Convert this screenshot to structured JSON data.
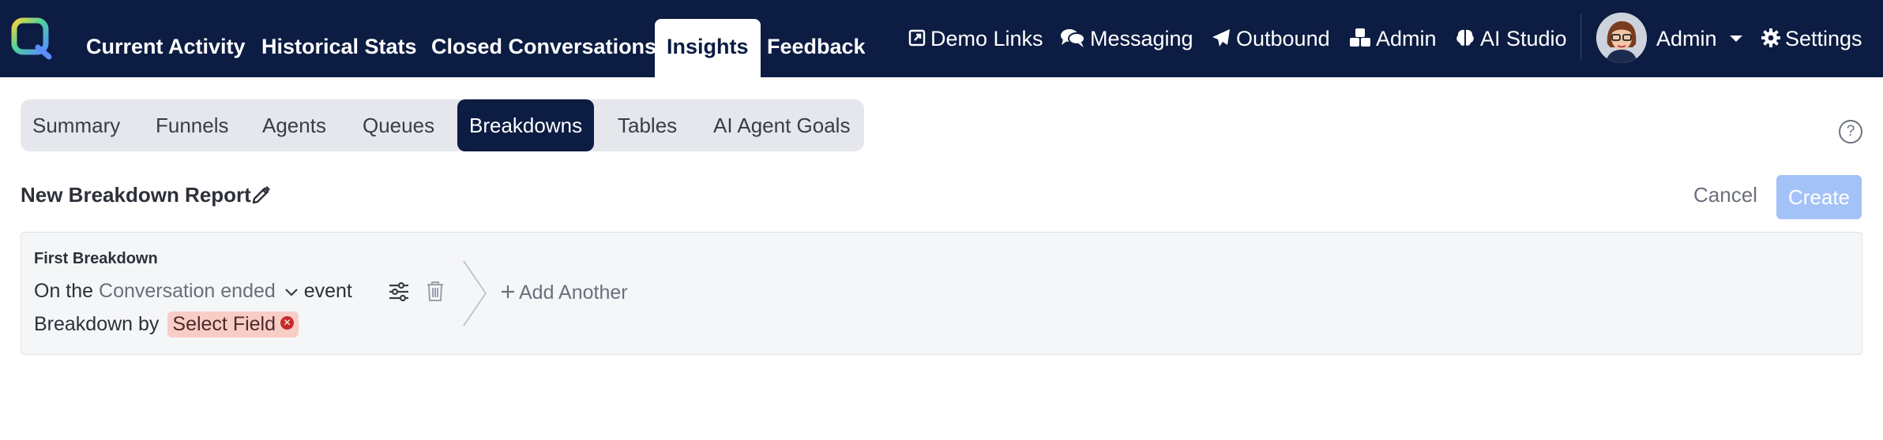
{
  "nav": {
    "tabs": [
      {
        "label": "Current Activity"
      },
      {
        "label": "Historical Stats"
      },
      {
        "label": "Closed Conversations"
      },
      {
        "label": "Insights"
      },
      {
        "label": "Feedback"
      }
    ],
    "active_tab": "Insights",
    "links": [
      {
        "label": "Demo Links",
        "icon": "external-link-icon"
      },
      {
        "label": "Messaging",
        "icon": "chat-bubbles-icon"
      },
      {
        "label": "Outbound",
        "icon": "paper-plane-icon"
      },
      {
        "label": "Admin",
        "icon": "cubes-icon"
      },
      {
        "label": "AI Studio",
        "icon": "brain-icon"
      }
    ],
    "user": {
      "label": "Admin",
      "icon": "caret-down-icon"
    },
    "settings": {
      "label": "Settings",
      "icon": "gear-icon"
    }
  },
  "subtabs": {
    "items": [
      {
        "label": "Summary"
      },
      {
        "label": "Funnels"
      },
      {
        "label": "Agents"
      },
      {
        "label": "Queues"
      },
      {
        "label": "Breakdowns"
      },
      {
        "label": "Tables"
      },
      {
        "label": "AI Agent Goals"
      }
    ],
    "active": "Breakdowns"
  },
  "help": {
    "label": "?"
  },
  "report": {
    "title": "New Breakdown Report",
    "cancel_label": "Cancel",
    "create_label": "Create"
  },
  "breakdown": {
    "label": "First Breakdown",
    "prefix": "On the",
    "event": "Conversation ended",
    "suffix": "event",
    "by_label": "Breakdown by",
    "field_placeholder": "Select Field",
    "add_label": "Add Another"
  },
  "colors": {
    "navbar": "#0c1c42",
    "accent": "#a3c2f8",
    "chip": "#f8cdc6",
    "chip_remove": "#c72b2b"
  }
}
